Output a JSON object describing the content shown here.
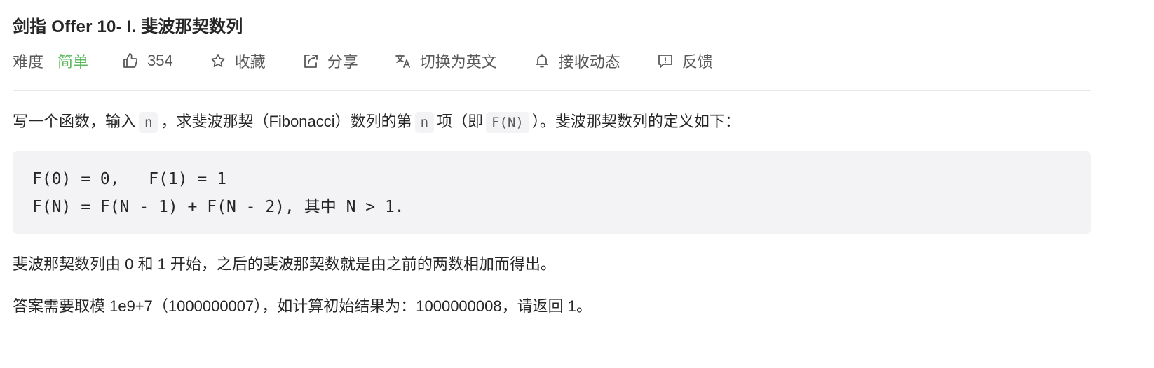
{
  "problem": {
    "title": "剑指 Offer 10- I. 斐波那契数列"
  },
  "meta": {
    "difficulty_label": "难度",
    "difficulty": "简单",
    "difficulty_color": "#5cb85c",
    "likes": "354",
    "favorite_label": "收藏",
    "share_label": "分享",
    "translate_label": "切换为英文",
    "subscribe_label": "接收动态",
    "feedback_label": "反馈"
  },
  "description": {
    "p1_a": "写一个函数，输入",
    "p1_code1": "n",
    "p1_b": "，求斐波那契（Fibonacci）数列的第",
    "p1_code2": "n",
    "p1_c": "项（即",
    "p1_code3": "F(N)",
    "p1_d": "）。斐波那契数列的定义如下：",
    "code_line1": "F(0) = 0,   F(1) = 1",
    "code_line2": "F(N) = F(N - 1) + F(N - 2), 其中 N > 1.",
    "p2": "斐波那契数列由 0 和 1 开始，之后的斐波那契数就是由之前的两数相加而得出。",
    "p3": "答案需要取模 1e9+7（1000000007），如计算初始结果为：1000000008，请返回 1。"
  }
}
